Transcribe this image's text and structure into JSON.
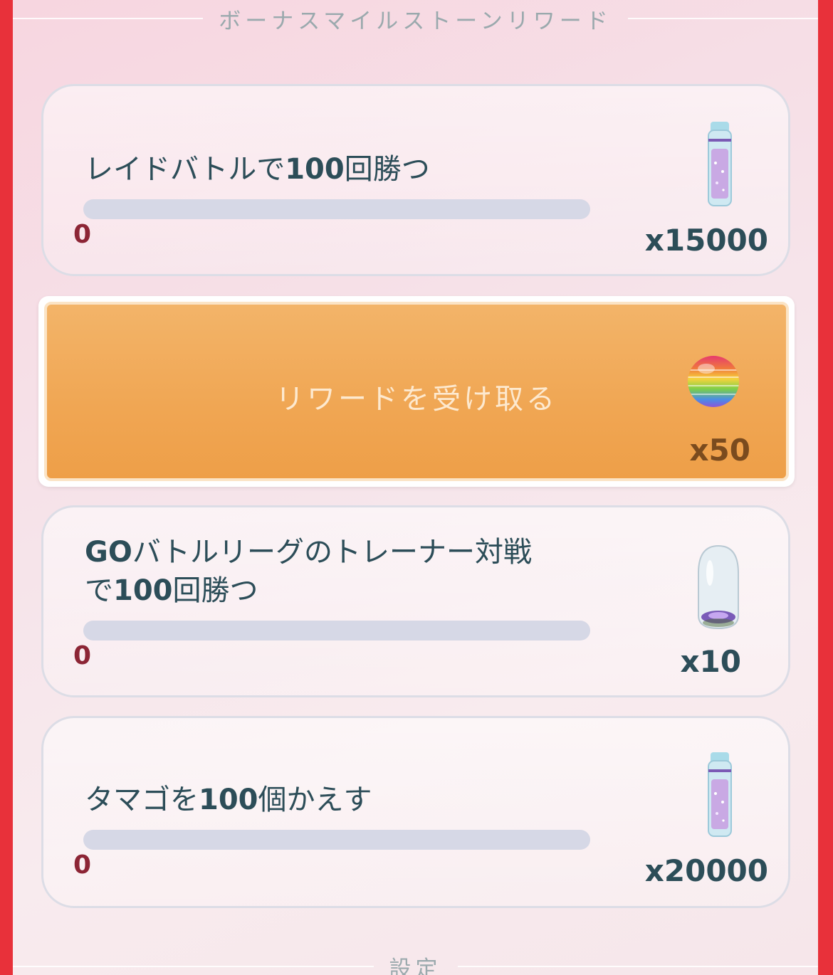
{
  "header": {
    "title": "ボーナスマイルストーンリワード"
  },
  "milestones": [
    {
      "label_pre": "レイドバトルで",
      "label_num": "100",
      "label_post": "回勝つ",
      "progress": 0,
      "progress_text": "0",
      "reward_icon": "stardust-bottle-icon",
      "reward_qty": "x15000"
    },
    {
      "claim_label": "リワードを受け取る",
      "reward_icon": "rainbow-sphere-icon",
      "reward_qty": "x50"
    },
    {
      "label_pre": "GO",
      "label_mid": "バトルリーグのトレーナー対戦",
      "label_line2_pre": "で",
      "label_num": "100",
      "label_post": "回勝つ",
      "progress": 0,
      "progress_text": "0",
      "reward_icon": "incense-capsule-icon",
      "reward_qty": "x10"
    },
    {
      "label_pre": "タマゴを",
      "label_num": "100",
      "label_post": "個かえす",
      "progress": 0,
      "progress_text": "0",
      "reward_icon": "stardust-bottle-icon",
      "reward_qty": "x20000"
    }
  ],
  "footer": {
    "title": "設定"
  },
  "colors": {
    "accent_orange": "#f0a653",
    "progress_track": "#d6d8e6",
    "text_dark": "#2c4d58",
    "count_red": "#8c2535",
    "border_red": "#e8313a"
  }
}
